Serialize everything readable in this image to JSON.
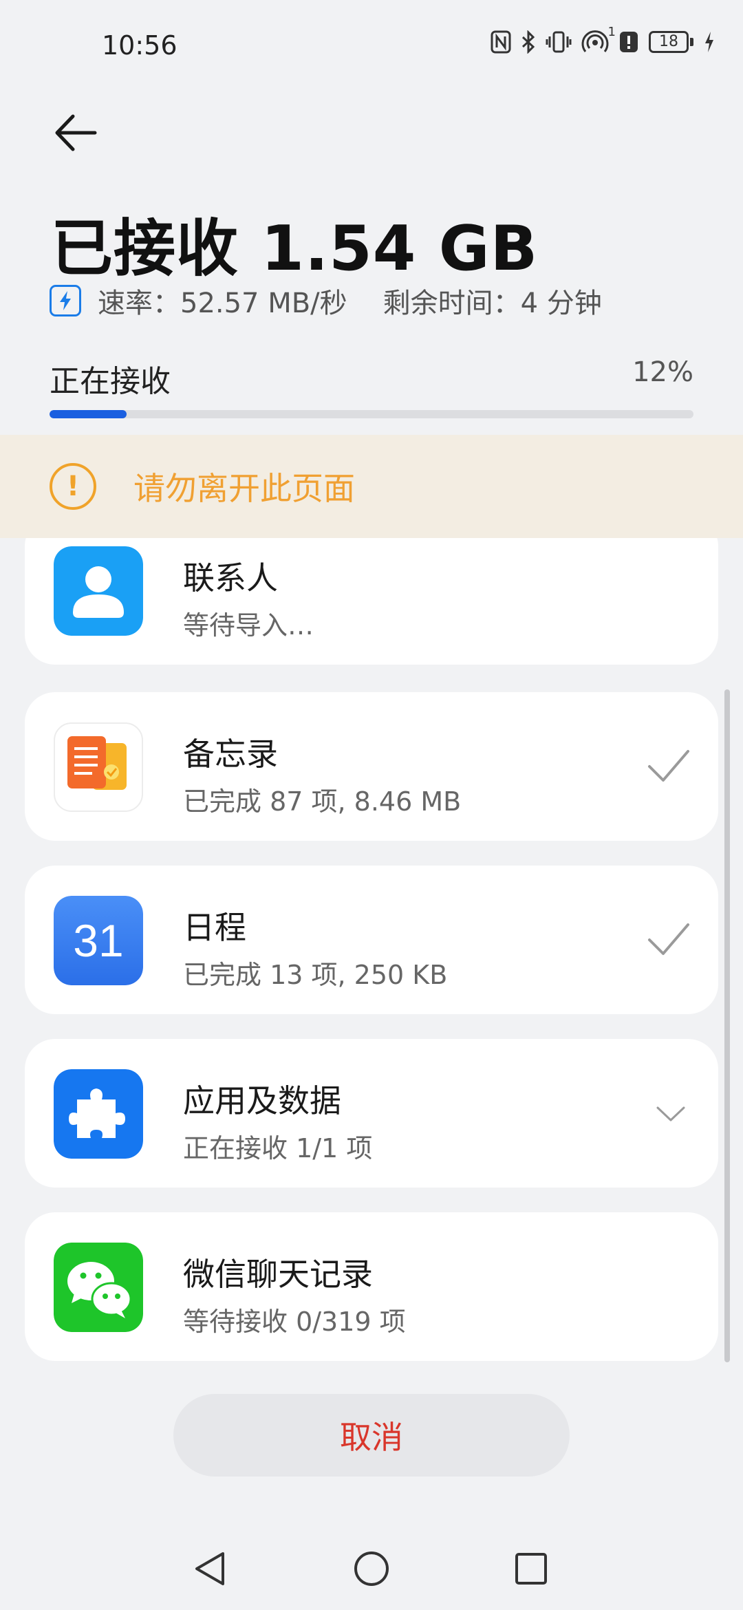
{
  "status_bar": {
    "time": "10:56",
    "battery_level": "18",
    "hotspot_count": "1"
  },
  "header": {
    "title": "已接收 1.54 GB",
    "rate": "速率：52.57 MB/秒",
    "remaining": "剩余时间：4 分钟"
  },
  "progress": {
    "label": "正在接收",
    "percent_text": "12%",
    "fraction": 0.12,
    "color": "#1a5fe0"
  },
  "warning": {
    "text": "请勿离开此页面",
    "color": "#f0a032"
  },
  "items": [
    {
      "title": "联系人",
      "subtitle": "等待导入…",
      "icon": "contacts-icon",
      "state": "waiting"
    },
    {
      "title": "备忘录",
      "subtitle": "已完成 87 项, 8.46 MB",
      "icon": "notes-icon",
      "state": "done"
    },
    {
      "title": "日程",
      "subtitle": "已完成 13 项, 250 KB",
      "icon": "calendar-icon",
      "icon_text": "31",
      "state": "done"
    },
    {
      "title": "应用及数据",
      "subtitle": "正在接收 1/1 项",
      "icon": "puzzle-icon",
      "state": "expandable"
    },
    {
      "title": "微信聊天记录",
      "subtitle": "等待接收 0/319 项",
      "icon": "wechat-icon",
      "state": "waiting"
    }
  ],
  "cancel_label": "取消",
  "colors": {
    "accent_blue": "#1a5fe0",
    "cancel_red": "#d9362b",
    "warning_orange": "#f0a032",
    "background": "#f1f2f4"
  }
}
